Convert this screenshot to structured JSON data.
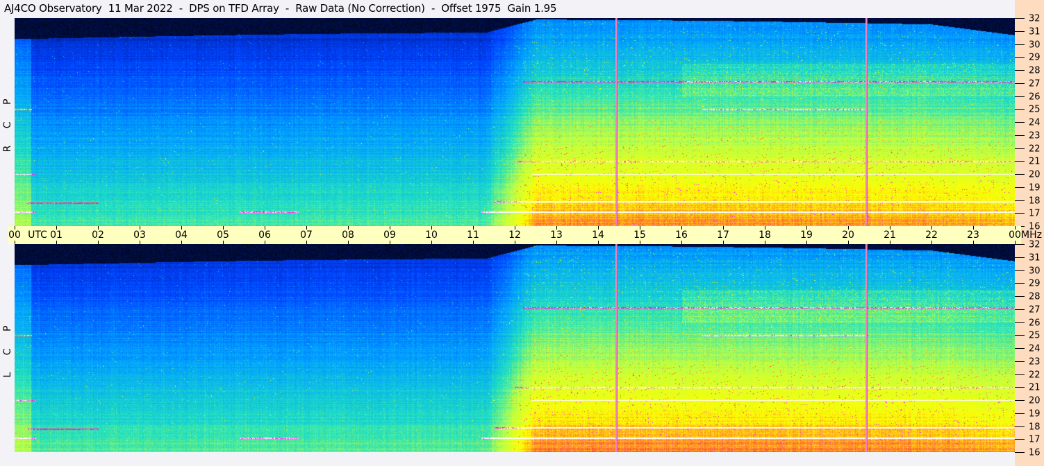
{
  "title": "AJ4CO Observatory  11 Mar 2022  -  DPS on TFD Array  -  Raw Data (No Correction)  -  Offset 1975  Gain 1.95",
  "panels": [
    {
      "id": "rcp",
      "label": "R C P"
    },
    {
      "id": "lcp",
      "label": "L C P"
    }
  ],
  "time_axis": {
    "unit": "UTC",
    "labels": [
      "00",
      "01",
      "02",
      "03",
      "04",
      "05",
      "06",
      "07",
      "08",
      "09",
      "10",
      "11",
      "12",
      "13",
      "14",
      "15",
      "16",
      "17",
      "18",
      "19",
      "20",
      "21",
      "22",
      "23",
      "00"
    ]
  },
  "freq_axis": {
    "unit": "MHz",
    "labels": [
      "32",
      "31",
      "30",
      "29",
      "28",
      "27",
      "26",
      "25",
      "24",
      "23",
      "22",
      "21",
      "20",
      "19",
      "18",
      "17",
      "16"
    ]
  },
  "colors": {
    "title_bg": "#f3f3f7",
    "time_strip": "#ffffc0",
    "right_axis": "#fddcc0",
    "marker_line": "#f0a060"
  },
  "chart_data": {
    "type": "heatmap",
    "title": "AJ4CO Observatory  11 Mar 2022  -  DPS on TFD Array  -  Raw Data (No Correction)  -  Offset 1975  Gain 1.95",
    "xlabel": "UTC",
    "ylabel": "MHz",
    "xlim": [
      0,
      24
    ],
    "ylim": [
      16,
      32
    ],
    "series": [
      {
        "name": "R C P"
      },
      {
        "name": "L C P"
      }
    ],
    "colormap": [
      "#000000",
      "#001a80",
      "#0040ff",
      "#00a0ff",
      "#20e0c0",
      "#c0ff40",
      "#ffff00",
      "#ff4040",
      "#ff00ff",
      "#ffffff"
    ],
    "marker_times_utc": [
      14.43,
      20.43
    ],
    "grid": false
  }
}
